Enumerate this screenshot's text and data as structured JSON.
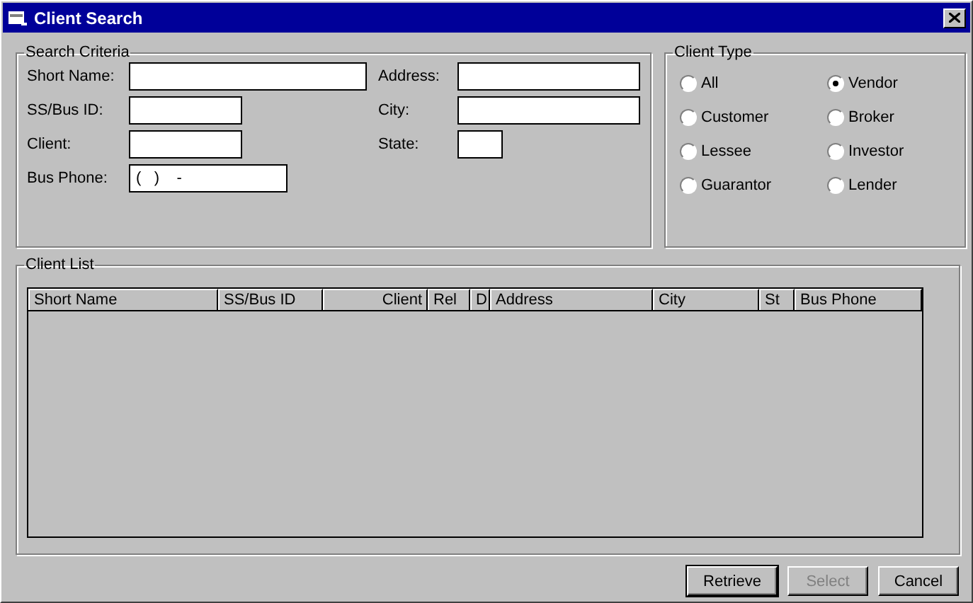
{
  "window": {
    "title": "Client Search"
  },
  "search_criteria": {
    "title": "Search Criteria",
    "left_fields": [
      {
        "label": "Short Name:"
      },
      {
        "label": "SS/Bus ID:"
      },
      {
        "label": "Client:"
      },
      {
        "label": "Bus Phone:",
        "value": "(   )    -"
      }
    ],
    "right_fields": [
      {
        "label": "Address:"
      },
      {
        "label": "City:"
      },
      {
        "label": "State:"
      }
    ]
  },
  "client_type": {
    "title": "Client Type",
    "options": [
      {
        "label": "All",
        "selected": false
      },
      {
        "label": "Vendor",
        "selected": true
      },
      {
        "label": "Customer",
        "selected": false
      },
      {
        "label": "Broker",
        "selected": false
      },
      {
        "label": "Lessee",
        "selected": false
      },
      {
        "label": "Investor",
        "selected": false
      },
      {
        "label": "Guarantor",
        "selected": false
      },
      {
        "label": "Lender",
        "selected": false
      }
    ]
  },
  "client_list": {
    "title": "Client List",
    "columns": [
      "Short Name",
      "SS/Bus ID",
      "Client",
      "Rel",
      "D",
      "Address",
      "City",
      "St",
      "Bus Phone"
    ]
  },
  "buttons": [
    {
      "label": "Retrieve",
      "disabled": false
    },
    {
      "label": "Select",
      "disabled": true
    },
    {
      "label": "Cancel",
      "disabled": false
    }
  ]
}
